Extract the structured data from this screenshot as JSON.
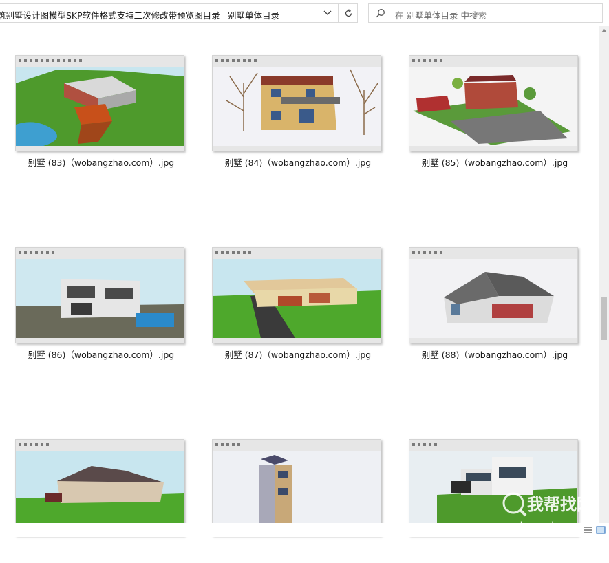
{
  "breadcrumb": {
    "path_1": "筑别墅设计图模型SKP软件格式支持二次修改带预览图目录",
    "separator": "›",
    "path_2": "别墅单体目录"
  },
  "search": {
    "placeholder": "在 别墅单体目录 中搜索"
  },
  "files": [
    {
      "name": "别墅 (83)（wobangzhao.com）.jpg"
    },
    {
      "name": "别墅 (84)（wobangzhao.com）.jpg"
    },
    {
      "name": "别墅 (85)（wobangzhao.com）.jpg"
    },
    {
      "name": "别墅 (86)（wobangzhao.com）.jpg"
    },
    {
      "name": "别墅 (87)（wobangzhao.com）.jpg"
    },
    {
      "name": "别墅 (88)（wobangzhao.com）.jpg"
    },
    {
      "name": ""
    },
    {
      "name": ""
    },
    {
      "name": ""
    }
  ],
  "watermark": {
    "brand": "我帮找网",
    "domain": "wobangzhao.com"
  },
  "colors": {
    "sky": "#c8e6ef",
    "grass": "#4e9a2c",
    "toolbar": "#e8e8e8"
  }
}
